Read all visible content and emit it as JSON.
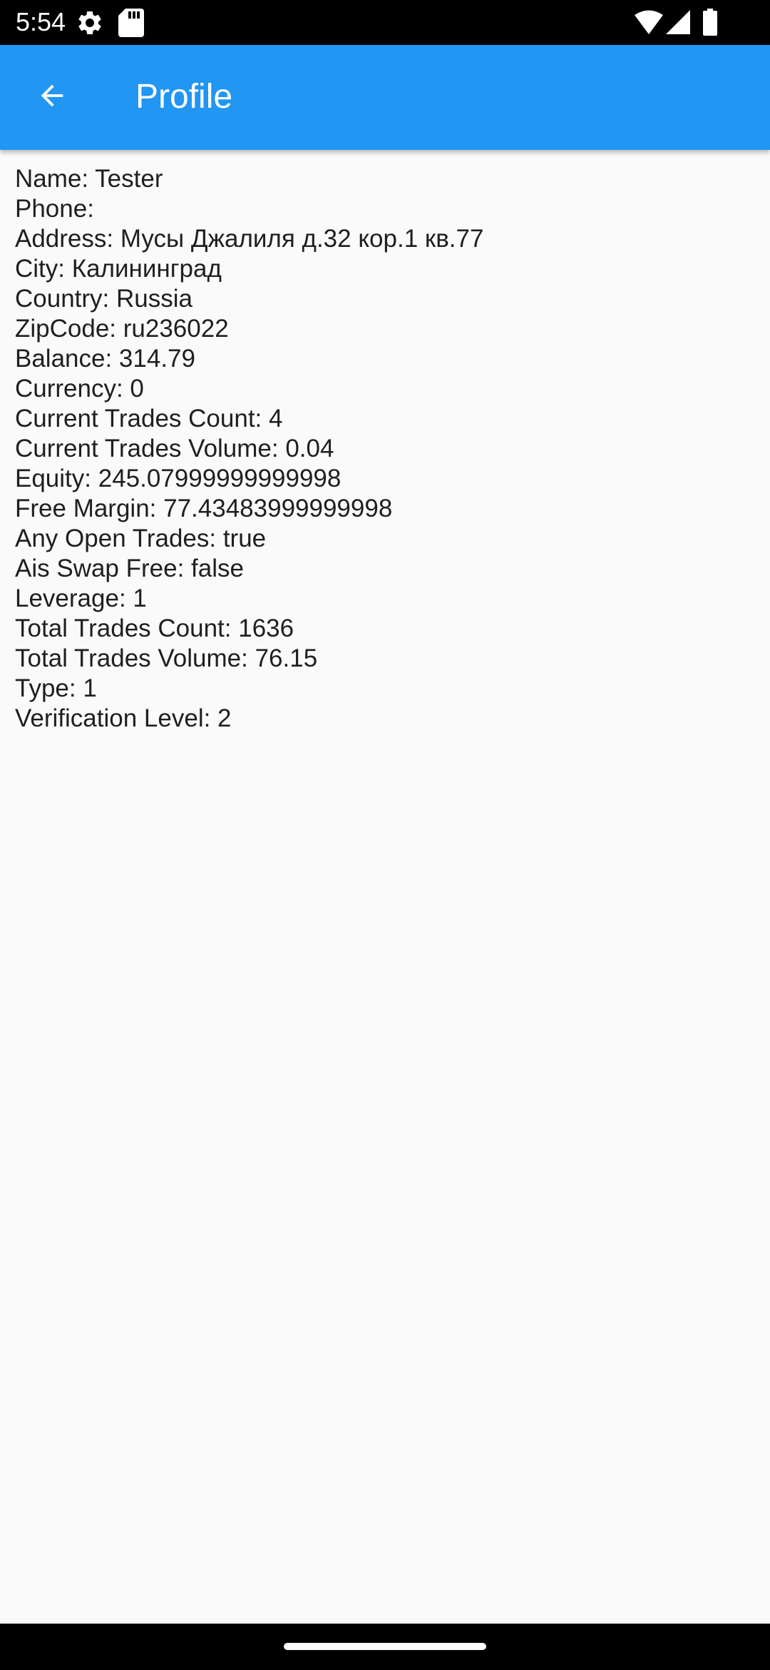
{
  "status_bar": {
    "time": "5:54",
    "icons": [
      "settings-gear-icon",
      "sd-card-icon",
      "wifi-icon",
      "cellular-signal-icon",
      "battery-icon"
    ]
  },
  "app_bar": {
    "title": "Profile",
    "back_icon": "arrow-back-icon",
    "background_color": "#2196f3"
  },
  "profile": {
    "lines": [
      "Name: Tester",
      "Phone:",
      "Address: Мусы Джалиля д.32 кор.1 кв.77",
      "City: Калининград",
      "Country: Russia",
      "ZipCode: ru236022",
      "Balance: 314.79",
      "Currency: 0",
      "Current Trades Count: 4",
      "Current Trades Volume: 0.04",
      "Equity: 245.07999999999998",
      "Free Margin: 77.43483999999998",
      "Any Open Trades: true",
      "Ais Swap Free: false",
      "Leverage: 1",
      "Total Trades Count: 1636",
      "Total Trades Volume: 76.15",
      "Type: 1",
      "Verification Level: 2"
    ]
  }
}
